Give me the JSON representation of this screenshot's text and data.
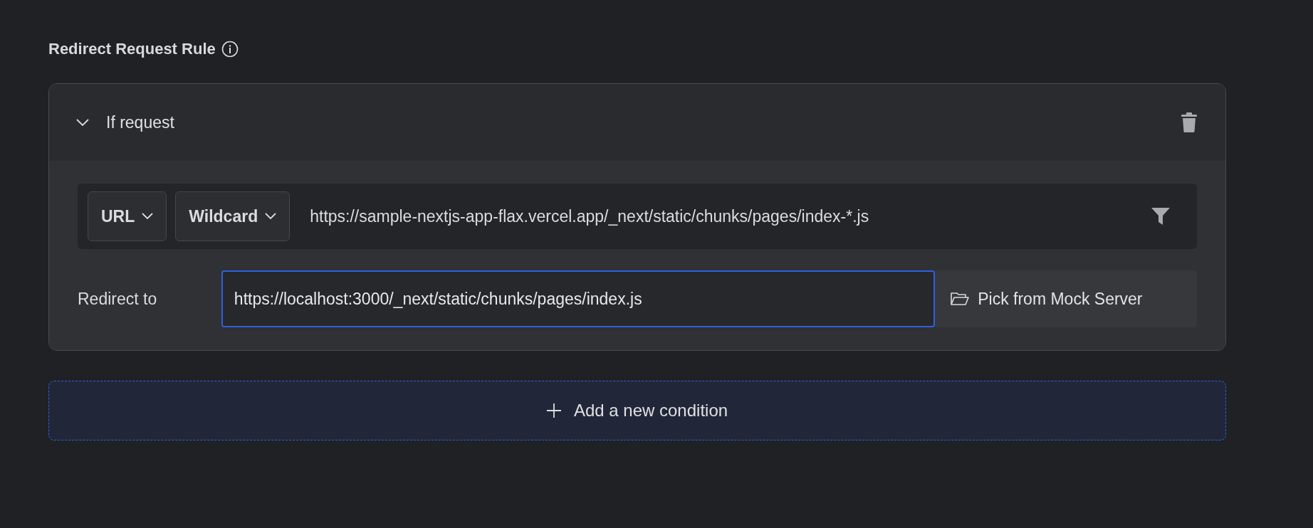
{
  "title": "Redirect Request Rule",
  "rule_card": {
    "header": "If request",
    "expanded": true,
    "condition": {
      "dropdowns": [
        "URL",
        "Wildcard"
      ],
      "value": "https://sample-nextjs-app-flax.vercel.app/_next/static/chunks/pages/index-*.js"
    },
    "redirect": {
      "label": "Redirect to",
      "value": "https://localhost:3000/_next/static/chunks/pages/index.js",
      "focused": true,
      "picker": "Pick from Mock Server"
    }
  },
  "add_condition": "Add a new condition"
}
